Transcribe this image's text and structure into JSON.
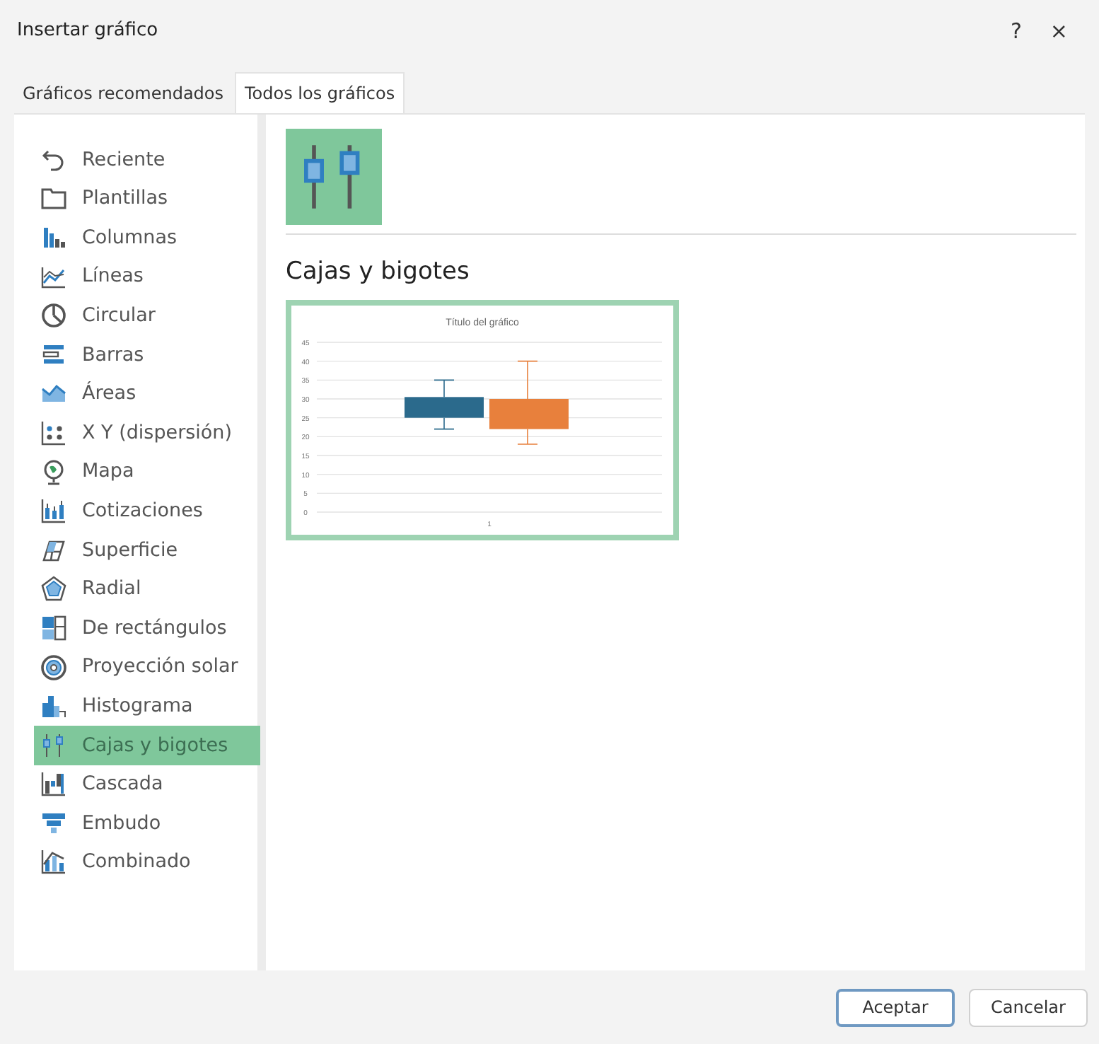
{
  "window": {
    "title": "Insertar gráfico",
    "help": "?",
    "close": "×"
  },
  "tabs": [
    {
      "label": "Gráficos recomendados",
      "selected": false
    },
    {
      "label": "Todos los gráficos",
      "selected": true
    }
  ],
  "sidebar": {
    "items": [
      {
        "label": "Reciente",
        "kind": "recent",
        "selected": false
      },
      {
        "label": "Plantillas",
        "kind": "folder",
        "selected": false
      },
      {
        "label": "Columnas",
        "kind": "column",
        "selected": false
      },
      {
        "label": "Líneas",
        "kind": "line",
        "selected": false
      },
      {
        "label": "Circular",
        "kind": "pie",
        "selected": false
      },
      {
        "label": "Barras",
        "kind": "bar",
        "selected": false
      },
      {
        "label": "Áreas",
        "kind": "area",
        "selected": false
      },
      {
        "label": "X Y (dispersión)",
        "kind": "scatter",
        "selected": false
      },
      {
        "label": "Mapa",
        "kind": "globe",
        "selected": false
      },
      {
        "label": "Cotizaciones",
        "kind": "stock",
        "selected": false
      },
      {
        "label": "Superficie",
        "kind": "surface",
        "selected": false
      },
      {
        "label": "Radial",
        "kind": "radar",
        "selected": false
      },
      {
        "label": "De rectángulos",
        "kind": "treemap",
        "selected": false
      },
      {
        "label": "Proyección solar",
        "kind": "sunburst",
        "selected": false
      },
      {
        "label": "Histograma",
        "kind": "histogram",
        "selected": false
      },
      {
        "label": "Cajas y bigotes",
        "kind": "boxplot",
        "selected": true
      },
      {
        "label": "Cascada",
        "kind": "waterfall",
        "selected": false
      },
      {
        "label": "Embudo",
        "kind": "funnel",
        "selected": false
      },
      {
        "label": "Combinado",
        "kind": "combo",
        "selected": false
      }
    ]
  },
  "subtypes": [
    {
      "kind": "boxplot",
      "selected": true
    }
  ],
  "heading": "Cajas y bigotes",
  "preview": {
    "title": "Título del gráfico",
    "axis_labels": [
      "45",
      "40",
      "35",
      "30",
      "25",
      "20",
      "15",
      "10",
      "5",
      "0"
    ],
    "category": "1"
  },
  "buttons": [
    {
      "label": "Aceptar",
      "kind": "primary"
    },
    {
      "label": "Cancelar",
      "kind": "secondary"
    }
  ]
}
